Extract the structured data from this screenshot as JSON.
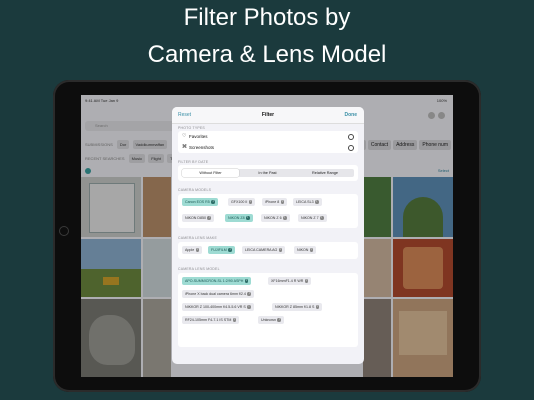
{
  "promo": {
    "title_line1": "Filter Photos by",
    "title_line2": "Camera & Lens Model"
  },
  "statusbar": {
    "time": "9:41 AM Tue Jan 9",
    "battery": "100%"
  },
  "library": {
    "search_placeholder": "Search",
    "row1_label": "SUBMISSIONS",
    "row1_chips": [
      "Dor",
      "Vaddkummaffan"
    ],
    "row2_label": "RECENT SEARCHES",
    "row2_chips": [
      "Music",
      "Flight",
      "Th"
    ],
    "right_chips": [
      "r",
      "Contact",
      "Address",
      "Phone num"
    ],
    "select_label": "Select"
  },
  "filter": {
    "reset_label": "Reset",
    "title": "Filter",
    "done_label": "Done",
    "photo_types": {
      "header": "PHOTO TYPES",
      "items": [
        {
          "icon": "heart-icon",
          "glyph": "♡",
          "label": "Favorites"
        },
        {
          "icon": "screenshot-icon",
          "glyph": "⌘",
          "label": "Screenshots"
        }
      ]
    },
    "date": {
      "header": "FILTER BY DATE",
      "options": [
        "Without Filter",
        "In the Past",
        "Relative Range"
      ],
      "selected": 0
    },
    "camera_models": {
      "header": "CAMERA MODELS",
      "tags": [
        {
          "label": "Canon EOS R5",
          "selected": true
        },
        {
          "label": "GFX100 II",
          "selected": false
        },
        {
          "label": "iPhone 8",
          "selected": false
        },
        {
          "label": "LEICA SL3",
          "selected": false
        },
        {
          "label": "NIKON D850",
          "selected": false
        },
        {
          "label": "NIKON Z8",
          "selected": true
        },
        {
          "label": "NIKON Z 6",
          "selected": false
        },
        {
          "label": "NIKON Z 7",
          "selected": false
        }
      ]
    },
    "camera_makes": {
      "header": "CAMERA LENS MAKE",
      "tags": [
        {
          "label": "Apple",
          "selected": false
        },
        {
          "label": "FUJIFILM",
          "selected": true
        },
        {
          "label": "LEICA CAMERA AG",
          "selected": false
        },
        {
          "label": "NIKON",
          "selected": false
        }
      ]
    },
    "lens_models": {
      "header": "CAMERA LENS MODEL",
      "tags": [
        {
          "label": "APO-SUMMICRON-SL 1:2/90 ASPH",
          "selected": true
        },
        {
          "label": "XF16mmF1.4 R WR",
          "selected": false
        },
        {
          "label": "iPhone X back dual camera 6mm f/2.4",
          "selected": false
        },
        {
          "label": "NIKKOR Z 100-400mm f/4.5-5.6 VR S",
          "selected": false
        },
        {
          "label": "NIKKOR Z 85mm f/1.8 S",
          "selected": false
        },
        {
          "label": "RF24-105mm F4-7.1 IS STM",
          "selected": false
        },
        {
          "label": "Unknown",
          "selected": false
        }
      ]
    }
  }
}
